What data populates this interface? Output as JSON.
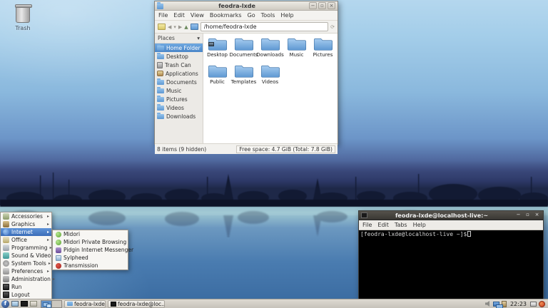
{
  "icons": {
    "minimize": "−",
    "maximize": "▫",
    "close": "×",
    "chevron_down": "▾",
    "submenu_arrow": "▸",
    "back": "◀",
    "forward": "▶",
    "up": "▲",
    "reload": "⟳"
  },
  "desktop": {
    "trash_label": "Trash"
  },
  "file_manager": {
    "title": "feodra-lxde",
    "menu": [
      "File",
      "Edit",
      "View",
      "Bookmarks",
      "Go",
      "Tools",
      "Help"
    ],
    "path": "/home/feodra-lxde",
    "places_header": "Places",
    "places": [
      {
        "label": "Home Folder"
      },
      {
        "label": "Desktop"
      },
      {
        "label": "Trash Can"
      },
      {
        "label": "Applications"
      },
      {
        "label": "Documents"
      },
      {
        "label": "Music"
      },
      {
        "label": "Pictures"
      },
      {
        "label": "Videos"
      },
      {
        "label": "Downloads"
      }
    ],
    "folders": [
      {
        "label": "Desktop"
      },
      {
        "label": "Documents"
      },
      {
        "label": "Downloads"
      },
      {
        "label": "Music"
      },
      {
        "label": "Pictures"
      },
      {
        "label": "Public"
      },
      {
        "label": "Templates"
      },
      {
        "label": "Videos"
      }
    ],
    "status_left": "8 items (9 hidden)",
    "status_right": "Free space: 4.7 GiB (Total: 7.8 GiB)"
  },
  "terminal": {
    "title": "feodra-lxde@localhost-live:~",
    "menu": [
      "File",
      "Edit",
      "Tabs",
      "Help"
    ],
    "prompt": "[feodra-lxde@localhost-live ~]$"
  },
  "app_menu": {
    "items": [
      {
        "label": "Accessories"
      },
      {
        "label": "Graphics"
      },
      {
        "label": "Internet"
      },
      {
        "label": "Office"
      },
      {
        "label": "Programming"
      },
      {
        "label": "Sound & Video"
      },
      {
        "label": "System Tools"
      },
      {
        "label": "Preferences"
      },
      {
        "label": "Administration"
      },
      {
        "label": "Run"
      },
      {
        "label": "Logout"
      }
    ],
    "submenu": [
      {
        "label": "Midori"
      },
      {
        "label": "Midori Private Browsing"
      },
      {
        "label": "Pidgin Internet Messenger"
      },
      {
        "label": "Sylpheed"
      },
      {
        "label": "Transmission"
      }
    ]
  },
  "taskbar": {
    "menu_logo": "f",
    "tasks": [
      {
        "label": "feodra-lxde"
      },
      {
        "label": "feodra-lxde@loc..."
      }
    ],
    "clock": "22:23"
  },
  "colors": {
    "selection_blue": "#4a86c8",
    "folder_blue": "#5e98d2",
    "wallpaper_top": "#b4d7ee",
    "wallpaper_band": "#2a3460",
    "wallpaper_bottom": "#38699f",
    "taskbar_bg": "#d6d2ca"
  }
}
